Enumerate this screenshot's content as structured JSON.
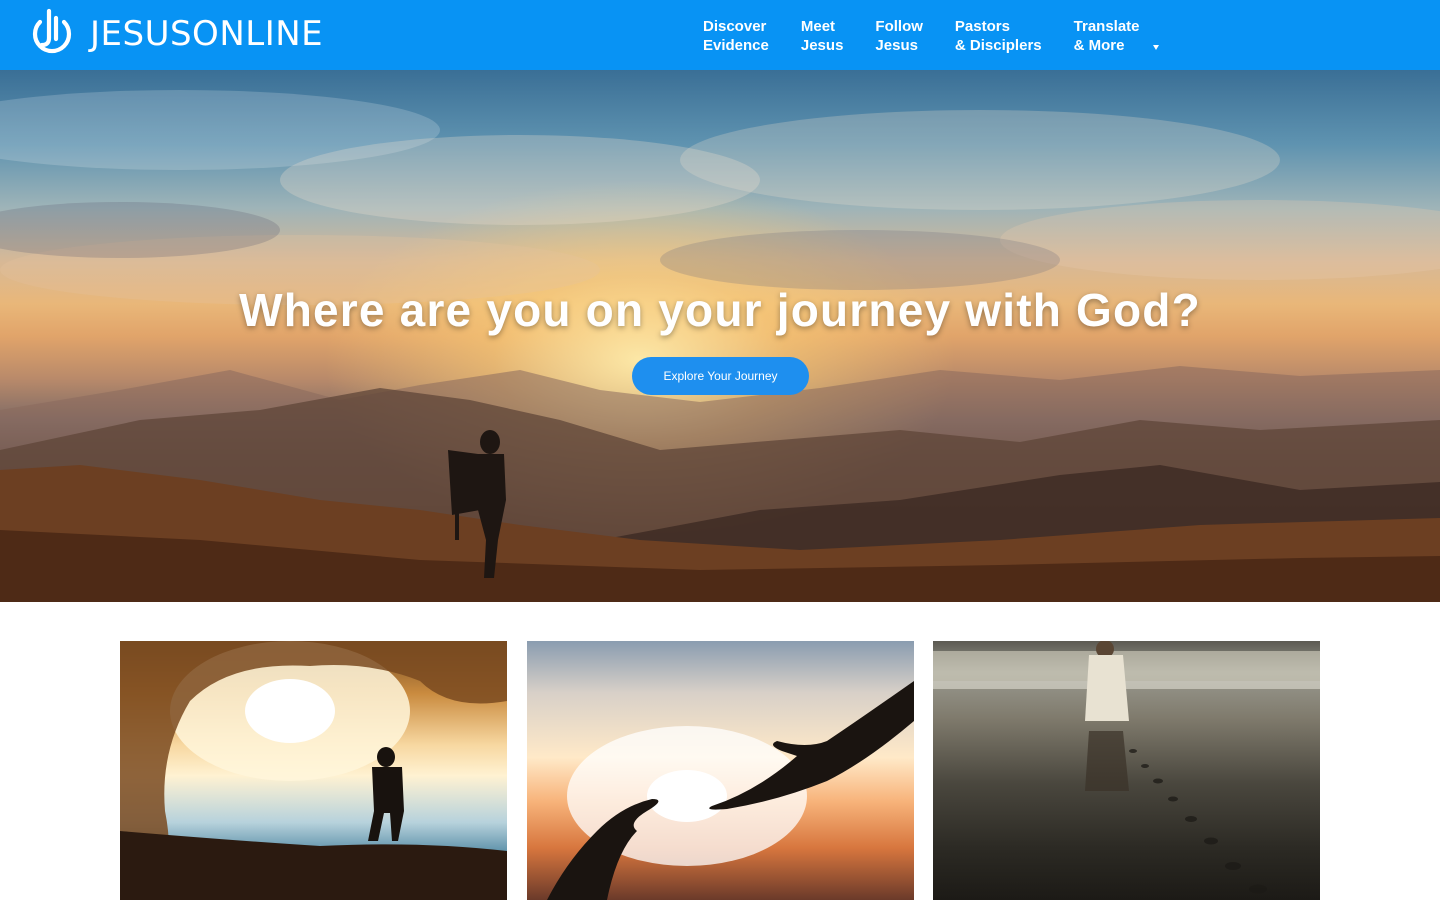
{
  "brand": {
    "name": "JESUSONLINE"
  },
  "nav": {
    "items": [
      {
        "line1": "Discover",
        "line2": "Evidence"
      },
      {
        "line1": "Meet",
        "line2": "Jesus"
      },
      {
        "line1": "Follow",
        "line2": "Jesus"
      },
      {
        "line1": "Pastors",
        "line2": "& Disciplers"
      },
      {
        "line1": "Translate",
        "line2": "& More"
      }
    ]
  },
  "hero": {
    "title": "Where are you on your journey with God?",
    "button_label": "Explore Your Journey"
  },
  "colors": {
    "header": "#0893f4",
    "button": "#1e8fef",
    "text_on_dark": "#ffffff"
  },
  "icons": [
    "logo-icon",
    "dropdown-caret-icon"
  ]
}
